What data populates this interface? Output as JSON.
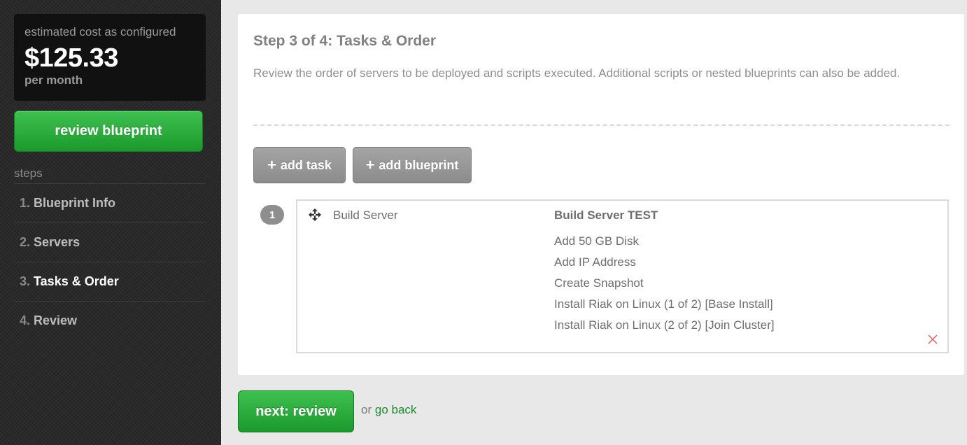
{
  "sidebar": {
    "cost": {
      "caption": "estimated cost as configured",
      "amount": "$125.33",
      "period": "per month"
    },
    "review_button": "review blueprint",
    "steps_label": "steps",
    "steps": [
      {
        "num": "1.",
        "label": "Blueprint Info",
        "active": false
      },
      {
        "num": "2.",
        "label": "Servers",
        "active": false
      },
      {
        "num": "3.",
        "label": "Tasks & Order",
        "active": true
      },
      {
        "num": "4.",
        "label": "Review",
        "active": false
      }
    ]
  },
  "main": {
    "title": "Step 3 of 4: Tasks & Order",
    "description": "Review the order of servers to be deployed and scripts executed. Additional scripts or nested blueprints can also be added.",
    "buttons": {
      "add_task": "add task",
      "add_blueprint": "add blueprint",
      "plus_glyph": "+"
    },
    "order_items": [
      {
        "order": "1",
        "server": "Build Server",
        "tasks_title": "Build Server TEST",
        "tasks": [
          "Add 50 GB Disk",
          "Add IP Address",
          "Create Snapshot",
          "Install Riak on Linux (1 of 2) [Base Install]",
          "Install Riak on Linux (2 of 2) [Join Cluster]"
        ]
      }
    ]
  },
  "footer": {
    "next_button": "next: review",
    "or_text": "or",
    "go_back": "go back"
  },
  "colors": {
    "accent_green": "#1b9a2c",
    "link_green": "#1a8a2a",
    "remove_red": "#e07070"
  },
  "icons": {
    "move": "move-arrows-icon",
    "remove": "close-icon"
  }
}
